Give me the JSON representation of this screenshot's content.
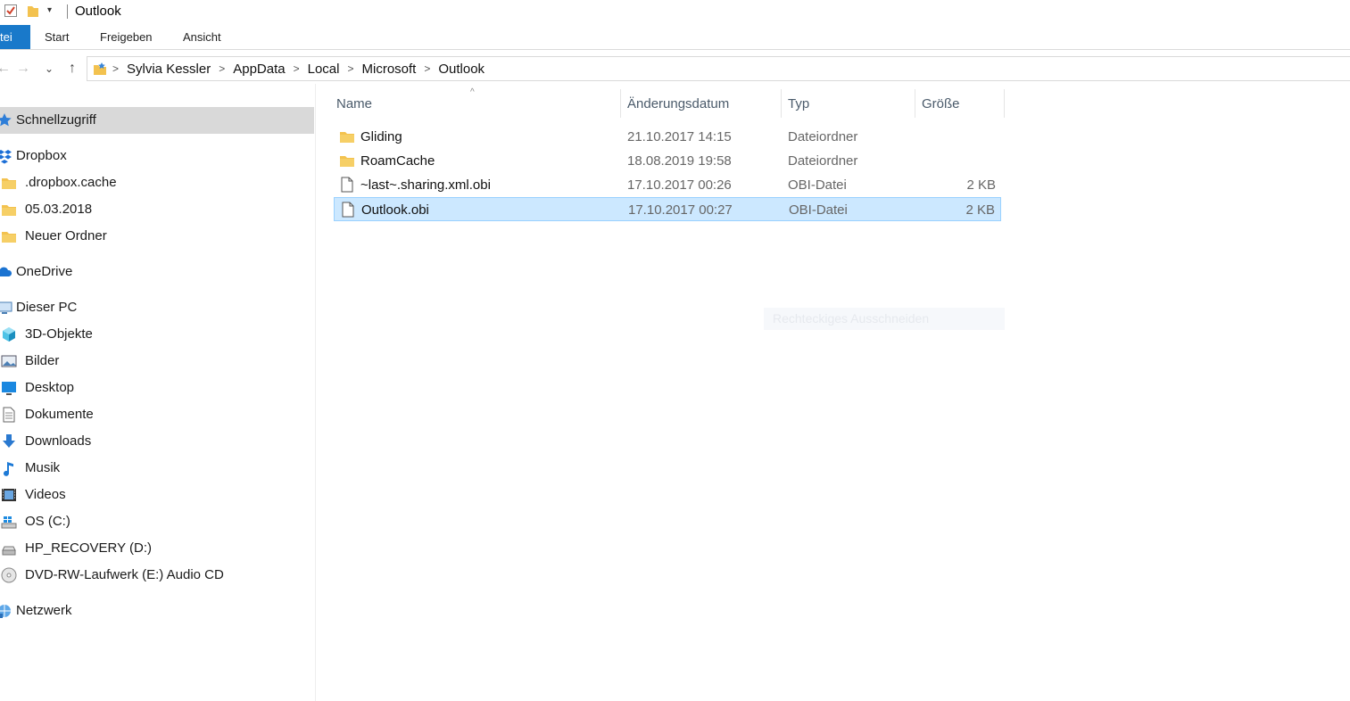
{
  "window": {
    "title": "Outlook",
    "qat_dropdown_glyph": "▾"
  },
  "ribbon": {
    "tabs": [
      {
        "label": "tei"
      },
      {
        "label": "Start"
      },
      {
        "label": "Freigeben"
      },
      {
        "label": "Ansicht"
      }
    ]
  },
  "nav": {
    "back_glyph": "←",
    "forward_glyph": "→",
    "recent_glyph": "⌄",
    "up_glyph": "↑"
  },
  "address": {
    "crumbs": [
      "Sylvia Kessler",
      "AppData",
      "Local",
      "Microsoft",
      "Outlook"
    ],
    "separator": ">"
  },
  "sidebar": {
    "items": [
      {
        "label": "Schnellzugriff",
        "icon": "star-icon",
        "selected": true
      },
      {
        "label": "Dropbox",
        "icon": "dropbox-icon"
      },
      {
        "label": ".dropbox.cache",
        "icon": "folder-icon"
      },
      {
        "label": "05.03.2018",
        "icon": "folder-icon"
      },
      {
        "label": "Neuer Ordner",
        "icon": "folder-icon"
      },
      {
        "label": "OneDrive",
        "icon": "cloud-icon"
      },
      {
        "label": "Dieser PC",
        "icon": "computer-icon"
      },
      {
        "label": "3D-Objekte",
        "icon": "cube-icon"
      },
      {
        "label": "Bilder",
        "icon": "pictures-icon"
      },
      {
        "label": "Desktop",
        "icon": "desktop-icon"
      },
      {
        "label": "Dokumente",
        "icon": "document-icon"
      },
      {
        "label": "Downloads",
        "icon": "download-icon"
      },
      {
        "label": "Musik",
        "icon": "music-icon"
      },
      {
        "label": "Videos",
        "icon": "video-icon"
      },
      {
        "label": "OS (C:)",
        "icon": "windows-drive-icon"
      },
      {
        "label": "HP_RECOVERY (D:)",
        "icon": "drive-icon"
      },
      {
        "label": "DVD-RW-Laufwerk (E:) Audio CD",
        "icon": "dvd-icon"
      },
      {
        "label": "Netzwerk",
        "icon": "network-icon"
      }
    ]
  },
  "columns": {
    "name": "Name",
    "date": "Änderungsdatum",
    "type": "Typ",
    "size": "Größe",
    "sort_glyph": "^"
  },
  "files": [
    {
      "name": "Gliding",
      "date": "21.10.2017 14:15",
      "type": "Dateiordner",
      "size": "",
      "icon": "folder-icon",
      "selected": false
    },
    {
      "name": "RoamCache",
      "date": "18.08.2019 19:58",
      "type": "Dateiordner",
      "size": "",
      "icon": "folder-icon",
      "selected": false
    },
    {
      "name": "~last~.sharing.xml.obi",
      "date": "17.10.2017 00:26",
      "type": "OBI-Datei",
      "size": "2 KB",
      "icon": "file-icon",
      "selected": false
    },
    {
      "name": "Outlook.obi",
      "date": "17.10.2017 00:27",
      "type": "OBI-Datei",
      "size": "2 KB",
      "icon": "file-icon",
      "selected": true
    }
  ],
  "ghost_tooltip": "Rechteckiges Ausschneiden",
  "colors": {
    "accent": "#1979ca",
    "selection_bg": "#cce8ff",
    "selection_border": "#99d1ff",
    "folder": "#f3c24f",
    "nav_selected": "#d9d9d9"
  }
}
